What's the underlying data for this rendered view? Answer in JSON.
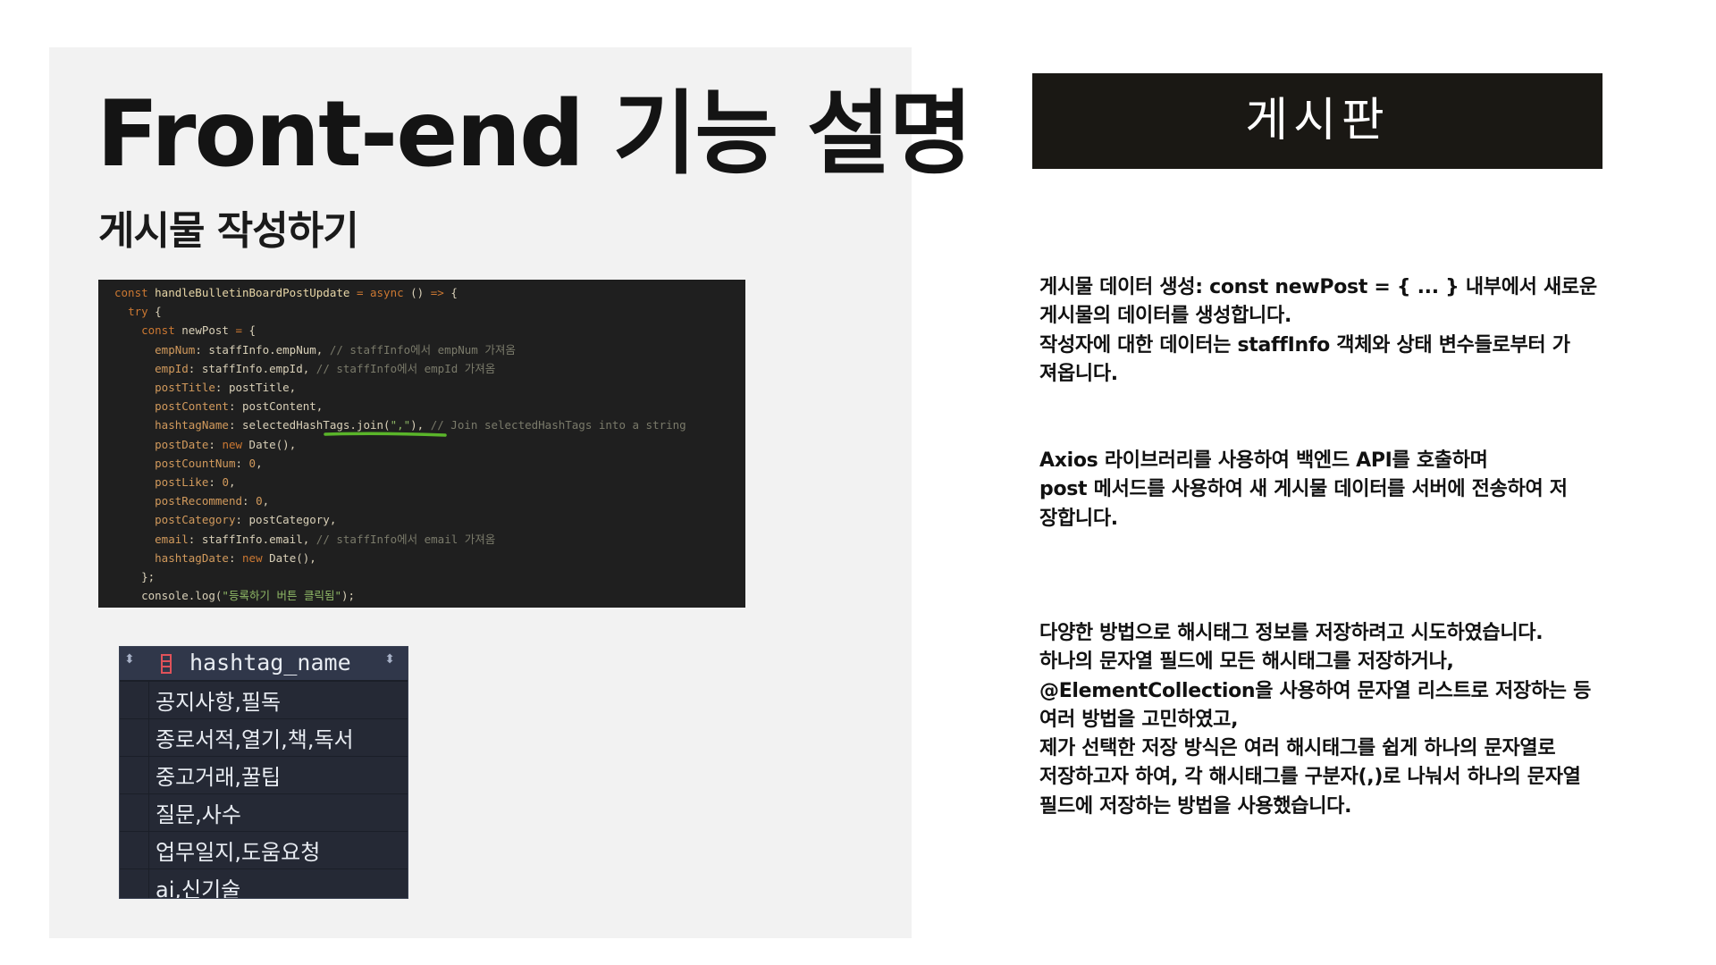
{
  "header": {
    "title": "Front-end 기능 설명",
    "subtitle": "게시물 작성하기"
  },
  "code": {
    "lines": [
      "const handleBulletinBoardPostUpdate = async () => {",
      "  try {",
      "    const newPost = {",
      "      empNum: staffInfo.empNum, // staffInfo에서 empNum 가져옴",
      "      empId: staffInfo.empId, // staffInfo에서 empId 가져옴",
      "      postTitle: postTitle,",
      "      postContent: postContent,",
      "      hashtagName: selectedHashTags.join(\",\"), // Join selectedHashTags into a string",
      "      postDate: new Date(),",
      "      postCountNum: 0,",
      "      postLike: 0,",
      "      postRecommend: 0,",
      "      postCategory: postCategory,",
      "      email: staffInfo.email, // staffInfo에서 email 가져옴",
      "      hashtagDate: new Date(),",
      "    };",
      "    console.log(\"등록하기 버튼 클릭됨\");"
    ]
  },
  "db_table": {
    "column": "hashtag_name",
    "rows": [
      "공지사항,필독",
      "종로서적,열기,책,독서",
      "중고거래,꿀팁",
      "질문,사수",
      "업무일지,도움요청",
      "ai,신기술"
    ]
  },
  "section": {
    "heading": "게시판"
  },
  "paragraphs": {
    "p1": [
      "게시물 데이터 생성: const newPost = { ... } 내부에서 새로운",
      "게시물의 데이터를 생성합니다.",
      "작성자에 대한 데이터는 staffInfo 객체와 상태 변수들로부터 가",
      "져옵니다."
    ],
    "p2": [
      "Axios 라이브러리를 사용하여 백엔드 API를 호출하며",
      "post 메서드를 사용하여 새 게시물 데이터를 서버에 전송하여 저",
      "장합니다."
    ],
    "p3": [
      "다양한 방법으로 해시태그 정보를 저장하려고 시도하였습니다.",
      "하나의 문자열 필드에 모든 해시태그를 저장하거나,",
      "@ElementCollection을 사용하여 문자열 리스트로 저장하는 등",
      "여러 방법을 고민하였고,",
      "제가 선택한 저장 방식은 여러 해시태그를 쉽게 하나의 문자열로",
      "저장하고자 하여, 각 해시태그를 구분자(,)로 나눠서 하나의 문자열",
      "필드에 저장하는 방법을 사용했습니다."
    ]
  },
  "colors": {
    "panel_bg": "#f2f2f2",
    "code_bg": "#1f1f1f",
    "header_bg": "#1a1814",
    "highlight_underline": "#5ab52a"
  }
}
